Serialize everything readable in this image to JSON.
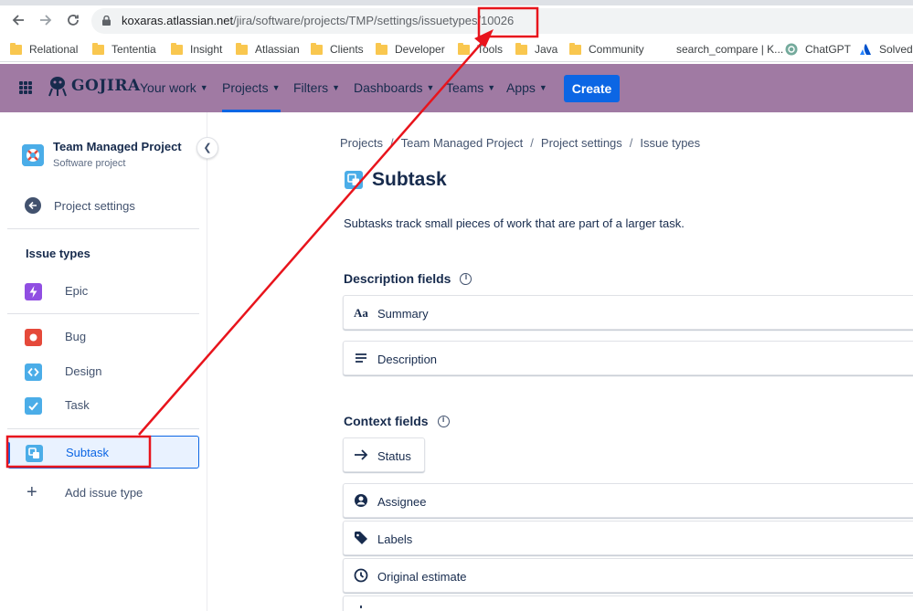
{
  "browser": {
    "url_host": "koxaras.atlassian.net",
    "url_path": "/jira/software/projects/TMP/settings/issuetypes/10026",
    "bookmarks": [
      {
        "label": "Relational",
        "icon": "folder-icon"
      },
      {
        "label": "Tententia",
        "icon": "folder-icon"
      },
      {
        "label": "Insight",
        "icon": "folder-icon"
      },
      {
        "label": "Atlassian",
        "icon": "folder-icon"
      },
      {
        "label": "Clients",
        "icon": "folder-icon"
      },
      {
        "label": "Developer",
        "icon": "folder-icon"
      },
      {
        "label": "Tools",
        "icon": "folder-icon"
      },
      {
        "label": "Java",
        "icon": "folder-icon"
      },
      {
        "label": "Community",
        "icon": "folder-icon"
      },
      {
        "label": "search_compare | K...",
        "icon": "none"
      },
      {
        "label": "ChatGPT",
        "icon": "chatgpt-icon"
      },
      {
        "label": "Solved:",
        "icon": "atlassian-icon"
      }
    ]
  },
  "topnav": {
    "logo": "GOJIRA",
    "items": [
      {
        "label": "Your work"
      },
      {
        "label": "Projects"
      },
      {
        "label": "Filters"
      },
      {
        "label": "Dashboards"
      },
      {
        "label": "Teams"
      },
      {
        "label": "Apps"
      }
    ],
    "create_label": "Create",
    "bg_color": "#a07aa3",
    "accent_color": "#0c66e4"
  },
  "sidebar": {
    "project_name": "Team Managed Project",
    "project_type": "Software project",
    "settings_label": "Project settings",
    "section_title": "Issue types",
    "issue_types": [
      {
        "label": "Epic",
        "icon": "epic-icon",
        "color": "#904ee2"
      },
      {
        "label": "Bug",
        "icon": "bug-icon",
        "color": "#e5493a"
      },
      {
        "label": "Design",
        "icon": "design-icon",
        "color": "#4bade8"
      },
      {
        "label": "Task",
        "icon": "task-icon",
        "color": "#4bade8"
      },
      {
        "label": "Subtask",
        "icon": "subtask-icon",
        "color": "#4bade8",
        "selected": true
      }
    ],
    "add_label": "Add issue type"
  },
  "main": {
    "breadcrumbs": [
      "Projects",
      "Team Managed Project",
      "Project settings",
      "Issue types"
    ],
    "title": "Subtask",
    "description": "Subtasks track small pieces of work that are part of a larger task.",
    "description_fields_title": "Description fields",
    "description_fields": [
      {
        "label": "Summary",
        "icon": "text-format-icon"
      },
      {
        "label": "Description",
        "icon": "paragraph-icon"
      }
    ],
    "context_fields_title": "Context fields",
    "context_fields": [
      {
        "label": "Status",
        "icon": "arrow-right-icon"
      },
      {
        "label": "Assignee",
        "icon": "person-icon"
      },
      {
        "label": "Labels",
        "icon": "tag-icon"
      },
      {
        "label": "Original estimate",
        "icon": "clock-icon"
      }
    ]
  },
  "annotation": {
    "color": "#e8141c"
  }
}
